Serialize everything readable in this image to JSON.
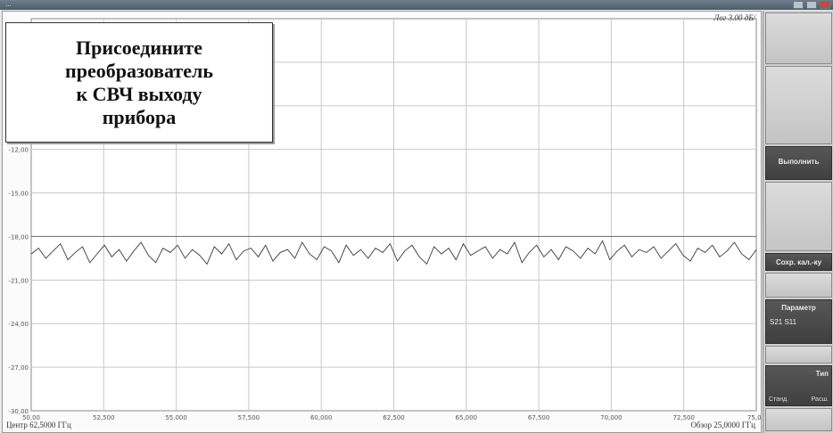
{
  "window": {
    "title": "..."
  },
  "overlay": {
    "lines": [
      "Присоедините",
      "преобразователь",
      "к СВЧ выходу",
      "прибора"
    ]
  },
  "scale_readout": "Лог 3.00 дБ/",
  "footer": {
    "center": "Центр 62,5000 ГГц",
    "span": "Обзор 25,0000 ГГц"
  },
  "softkeys": {
    "top_label": "",
    "execute": "Выполнить",
    "save_cal": "Сохр. кал.-ку",
    "parameter": {
      "label": "Параметр",
      "value": "S21 S11"
    },
    "type": {
      "label": "Тип",
      "opt1": "Станд.",
      "opt2": "Расш."
    }
  },
  "colors": {
    "trace": "#3a3a3a",
    "grid": "#c8c8c8",
    "reference_line": "#7a7a7a"
  },
  "chart_data": {
    "type": "line",
    "y_tick_labels": [
      "-12,00",
      "-15,00",
      "-18,00",
      "-21,00",
      "-24,00",
      "-27,00",
      "-30,00"
    ],
    "x_tick_labels": [
      "50,00",
      "52,500",
      "55,000",
      "57,500",
      "60,000",
      "62,500",
      "65,000",
      "67,500",
      "70,000",
      "72,500",
      "75,00"
    ],
    "xlim": [
      50,
      75
    ],
    "ylim": [
      -30,
      -3
    ],
    "ydiv": 3,
    "reference_level": -18,
    "series": [
      {
        "values": [
          -19.2,
          -18.8,
          -19.5,
          -19.0,
          -18.5,
          -19.6,
          -19.1,
          -18.7,
          -19.8,
          -19.2,
          -18.6,
          -19.4,
          -18.9,
          -19.7,
          -19.0,
          -18.4,
          -19.3,
          -19.8,
          -18.8,
          -19.1,
          -18.6,
          -19.5,
          -18.9,
          -19.3,
          -19.9,
          -18.7,
          -19.2,
          -18.5,
          -19.6,
          -19.0,
          -18.8,
          -19.4,
          -18.6,
          -19.7,
          -19.1,
          -18.9,
          -19.5,
          -18.4,
          -19.2,
          -19.6,
          -18.7,
          -19.0,
          -19.8,
          -18.6,
          -19.3,
          -18.9,
          -19.5,
          -18.8,
          -19.1,
          -18.5,
          -19.7,
          -19.0,
          -18.6,
          -19.4,
          -19.9,
          -18.7,
          -19.2,
          -18.8,
          -19.6,
          -18.5,
          -19.3,
          -19.0,
          -18.7,
          -19.5,
          -18.9,
          -19.2,
          -18.4,
          -19.8,
          -19.1,
          -18.6,
          -19.4,
          -18.9,
          -19.6,
          -18.7,
          -19.0,
          -19.5,
          -18.8,
          -19.2,
          -18.3,
          -19.6,
          -19.0,
          -18.6,
          -19.4,
          -18.9,
          -19.1,
          -18.7,
          -19.5,
          -19.0,
          -18.5,
          -19.3,
          -19.7,
          -18.8,
          -19.1,
          -18.6,
          -19.4,
          -19.0,
          -18.4,
          -19.2,
          -19.6,
          -18.9
        ]
      }
    ]
  }
}
